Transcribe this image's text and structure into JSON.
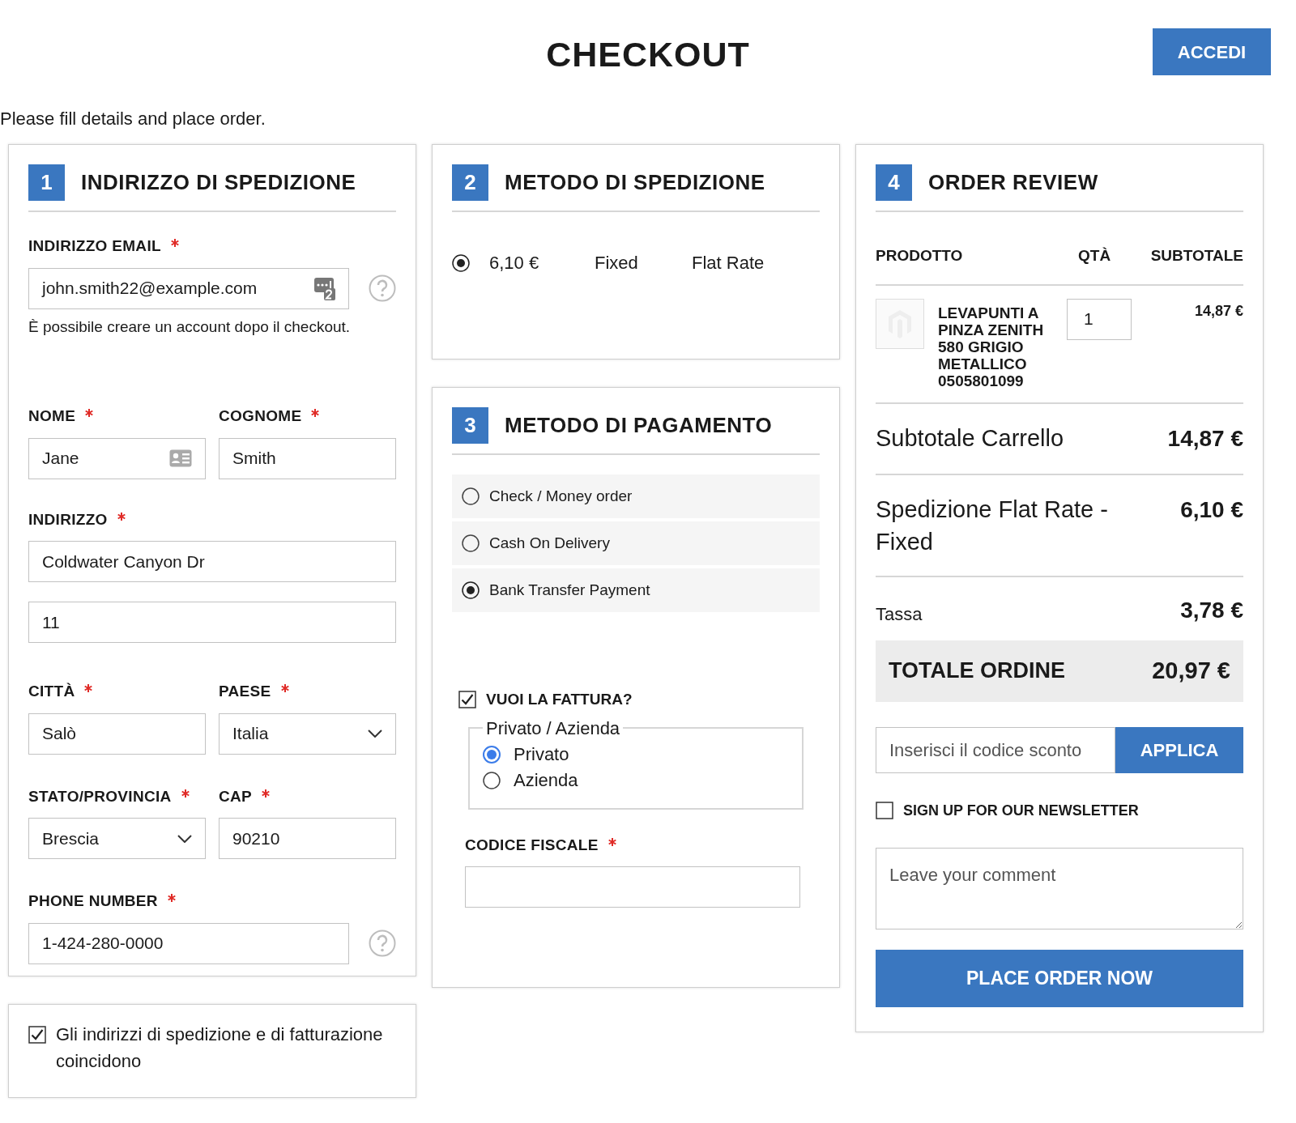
{
  "header": {
    "title": "CHECKOUT",
    "login_button": "ACCEDI"
  },
  "intro": "Please fill details and place order.",
  "shipping_address": {
    "step": "1",
    "title": "INDIRIZZO DI SPEDIZIONE",
    "email": {
      "label": "INDIRIZZO EMAIL",
      "required": true,
      "value": "john.smith22@example.com"
    },
    "email_note": "È possibile creare un account dopo il checkout.",
    "first_name": {
      "label": "NOME",
      "required": true,
      "value": "Jane"
    },
    "last_name": {
      "label": "COGNOME",
      "required": true,
      "value": "Smith"
    },
    "street": {
      "label": "INDIRIZZO",
      "required": true,
      "lines": [
        "Coldwater Canyon Dr",
        "11"
      ]
    },
    "city": {
      "label": "CITTÀ",
      "required": true,
      "value": "Salò"
    },
    "country": {
      "label": "PAESE",
      "required": true,
      "value": "Italia"
    },
    "region": {
      "label": "STATO/PROVINCIA",
      "required": true,
      "value": "Brescia"
    },
    "postcode": {
      "label": "CAP",
      "required": true,
      "value": "90210"
    },
    "phone": {
      "label": "PHONE NUMBER",
      "required": true,
      "value": "1-424-280-0000"
    },
    "same_address": {
      "label": "Gli indirizzi di spedizione e di fatturazione coincidono",
      "checked": true
    }
  },
  "shipping_method": {
    "step": "2",
    "title": "METODO DI SPEDIZIONE",
    "rates": [
      {
        "price": "6,10 €",
        "method": "Fixed",
        "carrier": "Flat Rate",
        "selected": true
      }
    ]
  },
  "payment_method": {
    "step": "3",
    "title": "METODO DI PAGAMENTO",
    "options": [
      {
        "label": "Check / Money order",
        "selected": false
      },
      {
        "label": "Cash On Delivery",
        "selected": false
      },
      {
        "label": "Bank Transfer Payment",
        "selected": true
      }
    ],
    "invoice": {
      "label": "VUOI LA FATTURA?",
      "checked": true
    },
    "customer_type": {
      "legend": "Privato / Azienda",
      "options": [
        {
          "label": "Privato",
          "selected": true
        },
        {
          "label": "Azienda",
          "selected": false
        }
      ]
    },
    "tax_code": {
      "label": "CODICE FISCALE",
      "required": true
    }
  },
  "order_review": {
    "step": "4",
    "title": "ORDER REVIEW",
    "columns": [
      "PRODOTTO",
      "QTÀ",
      "SUBTOTALE"
    ],
    "items": [
      {
        "name": "LEVAPUNTI A PINZA ZENITH 580 GRIGIO METALLICO 0505801099",
        "qty": "1",
        "subtotal": "14,87 €"
      }
    ],
    "totals": [
      {
        "kind": "line",
        "label": "Subtotale Carrello",
        "value": "14,87 €"
      },
      {
        "kind": "line",
        "label": "Spedizione Flat Rate - Fixed",
        "value": "6,10 €"
      },
      {
        "kind": "tax",
        "label": "Tassa",
        "value": "3,78 €"
      },
      {
        "kind": "grand",
        "label": "TOTALE ORDINE",
        "value": "20,97 €"
      }
    ],
    "discount": {
      "placeholder": "Inserisci il codice sconto",
      "button": "APPLICA"
    },
    "newsletter": {
      "label": "SIGN UP FOR OUR NEWSLETTER",
      "checked": false
    },
    "comment": {
      "placeholder": "Leave your comment"
    },
    "place_order": "PLACE ORDER NOW"
  }
}
